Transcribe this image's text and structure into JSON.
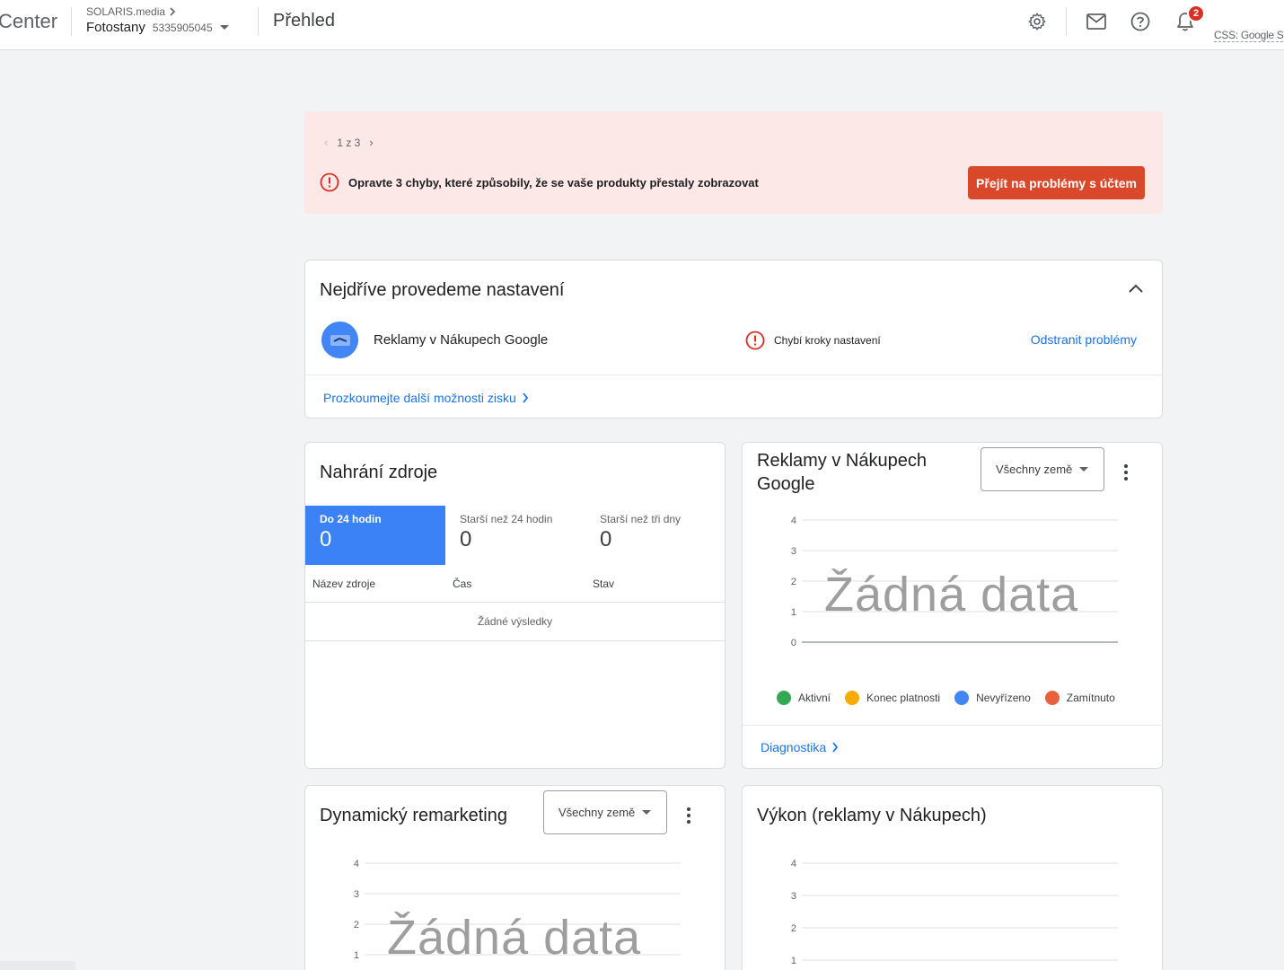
{
  "header": {
    "brand": "Center",
    "account_parent": "SOLARIS.media",
    "account_name": "Fotostany",
    "account_id": "5335905045",
    "page_title": "Přehled",
    "notifications_count": "2",
    "css_label": "CSS: Google S",
    "icons": [
      "settings-icon",
      "mail-icon",
      "help-icon",
      "bell-icon"
    ]
  },
  "alert": {
    "pager": "1 z 3",
    "message": "Opravte 3 chyby, které způsobily, že se vaše produkty přestaly zobrazovat",
    "button": "Přejít na problémy s účtem",
    "color": "#fce8e6",
    "button_color": "#d9482b"
  },
  "setup": {
    "title": "Nejdříve provedeme nastavení",
    "product_name": "Reklamy v Nákupech Google",
    "status": "Chybí kroky nastavení",
    "fix_link": "Odstranit problémy",
    "explore_link": "Prozkoumejte další možnosti zisku"
  },
  "feeds": {
    "title": "Nahrání zdroje",
    "tiles": [
      {
        "label": "Do 24 hodin",
        "value": "0"
      },
      {
        "label": "Starší než 24 hodin",
        "value": "0"
      },
      {
        "label": "Starší než tři dny",
        "value": "0"
      }
    ],
    "columns": [
      "Název zdroje",
      "Čas",
      "Stav"
    ],
    "empty": "Žádné výsledky"
  },
  "shopping_ads": {
    "title": "Reklamy v Nákupech Google",
    "dropdown": "Všechny země",
    "no_data": "Žádná data",
    "legend": [
      {
        "label": "Aktivní",
        "color": "#34a853"
      },
      {
        "label": "Konec platnosti",
        "color": "#f9ab00"
      },
      {
        "label": "Nevyřízeno",
        "color": "#4285f4"
      },
      {
        "label": "Zamítnuto",
        "color": "#e8603c"
      }
    ],
    "diagnostics_link": "Diagnostika"
  },
  "remarketing": {
    "title": "Dynamický remarketing",
    "dropdown": "Všechny země",
    "no_data": "Žádná data"
  },
  "performance": {
    "title": "Výkon (reklamy v Nákupech)"
  },
  "chart_data": [
    {
      "type": "line",
      "title": "Reklamy v Nákupech Google",
      "ylim": [
        0,
        4
      ],
      "y_ticks": [
        "4",
        "3",
        "2",
        "1",
        "0"
      ],
      "series": [],
      "grid": true,
      "legend": "bottom"
    },
    {
      "type": "line",
      "title": "Dynamický remarketing",
      "ylim": [
        0,
        4
      ],
      "y_ticks": [
        "4",
        "3",
        "2",
        "1"
      ],
      "series": [],
      "grid": true
    },
    {
      "type": "line",
      "title": "Výkon (reklamy v Nákupech)",
      "ylim": [
        0,
        4
      ],
      "y_ticks": [
        "4",
        "3",
        "2",
        "1"
      ],
      "series": [],
      "grid": true
    }
  ]
}
